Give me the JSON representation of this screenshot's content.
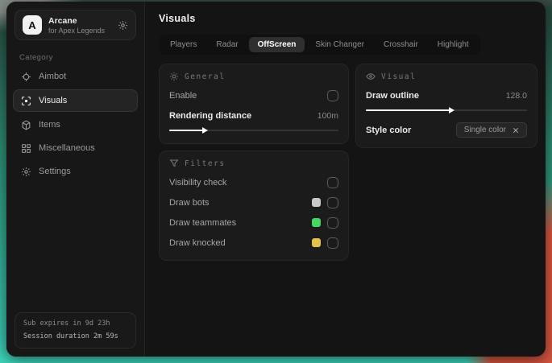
{
  "app": {
    "initial": "A",
    "name": "Arcane",
    "subtitle": "for Apex Legends"
  },
  "sidebar": {
    "category_label": "Category",
    "items": [
      {
        "label": "Aimbot",
        "icon": "crosshair-icon",
        "active": false
      },
      {
        "label": "Visuals",
        "icon": "eye-scan-icon",
        "active": true
      },
      {
        "label": "Items",
        "icon": "cube-icon",
        "active": false
      },
      {
        "label": "Miscellaneous",
        "icon": "grid-icon",
        "active": false
      },
      {
        "label": "Settings",
        "icon": "gear-icon",
        "active": false
      }
    ],
    "status": {
      "line1": "Sub expires in 9d 23h",
      "line2": "Session duration 2m 59s"
    }
  },
  "header": {
    "title": "Visuals"
  },
  "tabs": [
    {
      "label": "Players",
      "active": false
    },
    {
      "label": "Radar",
      "active": false
    },
    {
      "label": "OffScreen",
      "active": true
    },
    {
      "label": "Skin Changer",
      "active": false
    },
    {
      "label": "Crosshair",
      "active": false
    },
    {
      "label": "Highlight",
      "active": false
    }
  ],
  "panels": {
    "general": {
      "title": "General",
      "icon": "sun-icon",
      "enable_label": "Enable",
      "enable_checked": false,
      "slider": {
        "label": "Rendering distance",
        "value": "100m",
        "fill": "20%"
      }
    },
    "visual": {
      "title": "Visual",
      "icon": "eye-icon",
      "slider": {
        "label": "Draw outline",
        "value": "128.0",
        "fill": "52%"
      },
      "style_color": {
        "label": "Style color",
        "chip": "Single color"
      }
    },
    "filters": {
      "title": "Filters",
      "icon": "funnel-icon",
      "rows": [
        {
          "label": "Visibility check",
          "checked": false
        },
        {
          "label": "Draw bots",
          "swatch": "#c9c9c9",
          "checked": false
        },
        {
          "label": "Draw teammates",
          "swatch": "#45d763",
          "checked": false
        },
        {
          "label": "Draw knocked",
          "swatch": "#e2c24d",
          "checked": false
        }
      ]
    }
  },
  "colors": {
    "accent_teal": "#38c3ab",
    "background_red": "#d65440",
    "window_bg": "#141414",
    "panel_bg": "#1b1b1b",
    "active_tab_bg": "#2f2f2f",
    "text_primary": "#f0f0f0",
    "text_muted": "#8c8c8c"
  }
}
